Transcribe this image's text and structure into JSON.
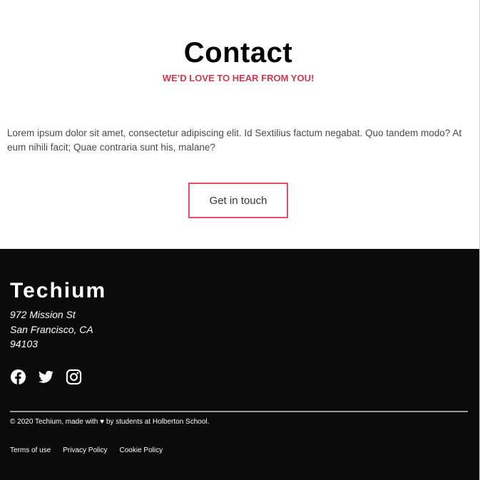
{
  "contact": {
    "title": "Contact",
    "subtitle": "WE’D LOVE TO HEAR FROM YOU!",
    "body": "Lorem ipsum dolor sit amet, consectetur adipiscing elit. Id Sextilius factum negabat. Quo tandem modo? At eum nihili facit; Quae contraria sunt his, malane?",
    "cta_label": "Get in touch"
  },
  "footer": {
    "brand": "Techium",
    "address": {
      "line1": "972 Mission St",
      "line2": "San Francisco, CA",
      "line3": "94103"
    },
    "socials": [
      {
        "icon": "facebook-icon"
      },
      {
        "icon": "twitter-icon"
      },
      {
        "icon": "instagram-icon"
      }
    ],
    "copyright": "© 2020 Techium, made with ♥ by students at Holberton School.",
    "links": [
      "Terms of use",
      "Privacy Policy",
      "Cookie Policy"
    ]
  },
  "colors": {
    "accent": "#d6374f",
    "button_border": "#e0506a",
    "footer_bg": "#0b0b0b",
    "text_body": "#4a4a4a"
  }
}
